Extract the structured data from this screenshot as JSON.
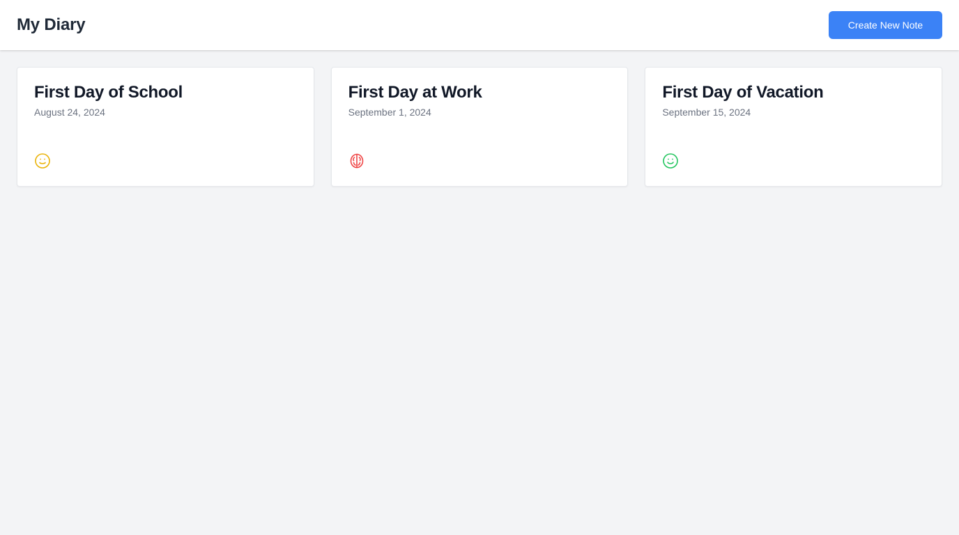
{
  "header": {
    "title": "My Diary",
    "create_button_label": "Create New Note"
  },
  "notes": [
    {
      "title": "First Day of School",
      "date": "August 24, 2024",
      "mood_icon": "smile-icon",
      "mood_color": "#eab308"
    },
    {
      "title": "First Day at Work",
      "date": "September 1, 2024",
      "mood_icon": "brain-icon",
      "mood_color": "#ef4444"
    },
    {
      "title": "First Day of Vacation",
      "date": "September 15, 2024",
      "mood_icon": "smile-icon",
      "mood_color": "#22c55e"
    }
  ],
  "colors": {
    "accent": "#3b82f6",
    "background": "#f3f4f6"
  }
}
